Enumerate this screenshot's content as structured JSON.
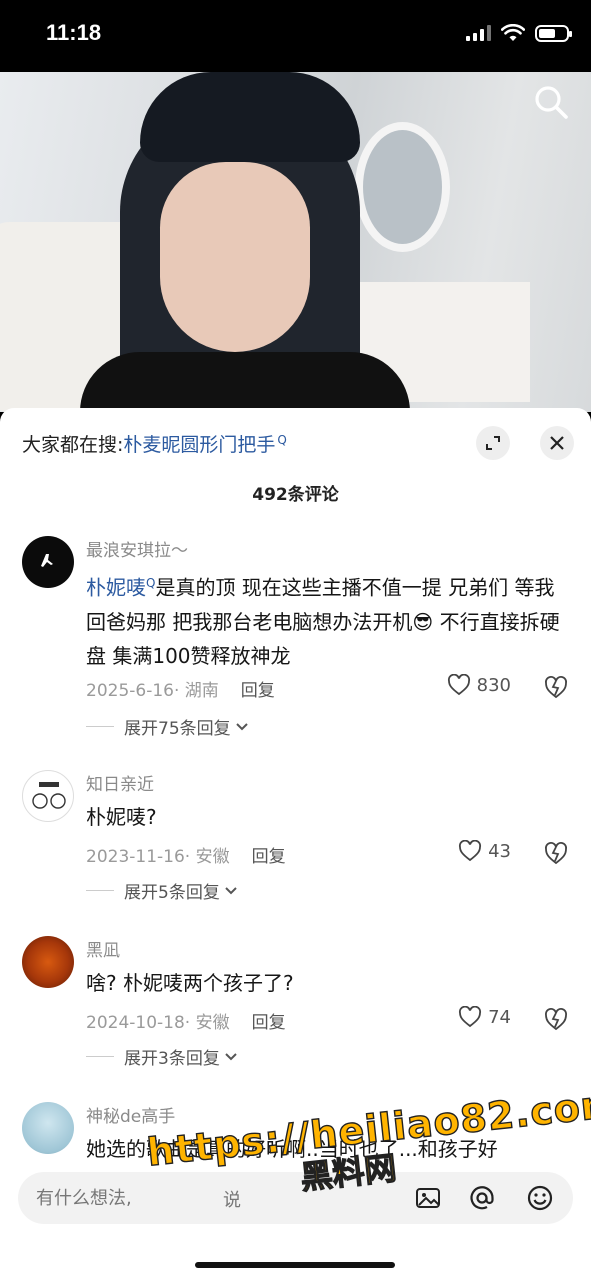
{
  "status_bar": {
    "time": "11:18",
    "battery_level": 0.6
  },
  "video": {
    "search_icon": "search-icon"
  },
  "sheet": {
    "search_prefix": "大家都在搜:",
    "search_term": "朴麦昵圆形门把手",
    "search_sup": "Q",
    "comment_count": "492条评论",
    "expand_icon": "fullscreen-icon",
    "close_icon": "close-icon"
  },
  "comments": [
    {
      "username": "最浪安琪拉～",
      "mention": "朴妮唛",
      "mention_sup": "Q",
      "text": "是真的顶 现在这些主播不值一提 兄弟们 等我回爸妈那 把我那台老电脑想办法开机😎 不行直接拆硬盘 集满100赞释放神龙",
      "date": "2025-6-16· 湖南",
      "reply_label": "回复",
      "likes": "830",
      "expand_label": "展开75条回复"
    },
    {
      "username": "知日亲近",
      "text": "朴妮唛?",
      "date": "2023-11-16· 安徽",
      "reply_label": "回复",
      "likes": "43",
      "expand_label": "展开5条回复"
    },
    {
      "username": "黑凪",
      "text": "啥? 朴妮唛两个孩子了?",
      "date": "2024-10-18· 安徽",
      "reply_label": "回复",
      "likes": "74",
      "expand_label": "展开3条回复"
    },
    {
      "username": "神秘de高手",
      "text": "她选的歌曲是真的好听啊..当时也了...和孩子好"
    }
  ],
  "input": {
    "placeholder": "有什么想法,",
    "placeholder_tail": "说"
  },
  "watermark": {
    "url": "https://heiliao82.com",
    "name": "黑料网"
  }
}
